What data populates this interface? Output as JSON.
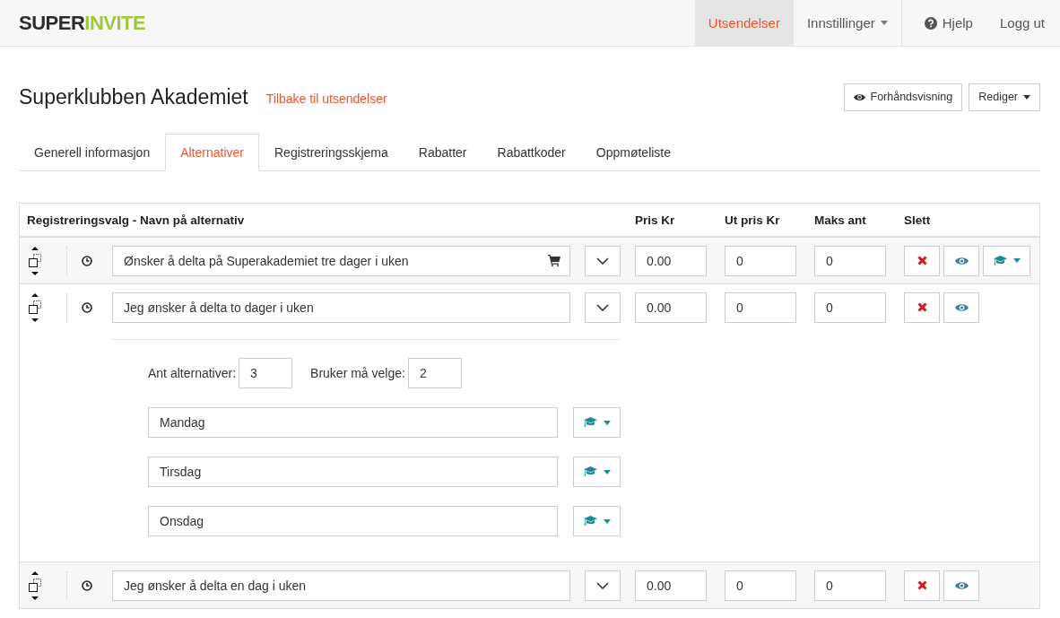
{
  "navbar": {
    "logo": {
      "dark": "SUPER",
      "green": "INVITE"
    },
    "items": [
      {
        "label": "Utsendelser",
        "kind": "link",
        "selected": true
      },
      {
        "label": "Innstillinger",
        "kind": "dropdown",
        "selected": false
      }
    ],
    "right_items": [
      {
        "label": "Hjelp",
        "kind": "help"
      },
      {
        "label": "Logg ut",
        "kind": "link"
      }
    ]
  },
  "header": {
    "title": "Superklubben Akademiet",
    "back_link": "Tilbake til utsendelser",
    "buttons": [
      {
        "label": "Forhåndsvisning",
        "kind": "preview"
      },
      {
        "label": "Rediger",
        "kind": "dropdown"
      }
    ]
  },
  "tabs": [
    {
      "label": "Generell informasjon",
      "selected": false
    },
    {
      "label": "Alternativer",
      "selected": true
    },
    {
      "label": "Registreringsskjema",
      "selected": false
    },
    {
      "label": "Rabatter",
      "selected": false
    },
    {
      "label": "Rabattkoder",
      "selected": false
    },
    {
      "label": "Oppmøteliste",
      "selected": false
    }
  ],
  "table": {
    "columns": [
      "Registreringsvalg - Navn på alternativ",
      "Pris Kr",
      "Ut pris Kr",
      "Maks ant",
      "Slett"
    ],
    "rows": [
      {
        "name": "Ønsker å delta på Superakademiet tre dager i uken",
        "price": "0.00",
        "out_price": "0",
        "max": "0",
        "cart": true,
        "cap_menu": true,
        "expanded": false
      },
      {
        "name": "Jeg ønsker å delta to dager i uken",
        "price": "0.00",
        "out_price": "0",
        "max": "0",
        "cart": false,
        "cap_menu": false,
        "expanded": true,
        "sub": {
          "count_label": "Ant alternativer:",
          "count": "3",
          "must_label": "Bruker må velge:",
          "must": "2",
          "options": [
            "Mandag",
            "Tirsdag",
            "Onsdag"
          ]
        }
      },
      {
        "name": "Jeg ønsker å delta en dag i uken",
        "price": "0.00",
        "out_price": "0",
        "max": "0",
        "cart": false,
        "cap_menu": false,
        "expanded": false
      }
    ]
  }
}
